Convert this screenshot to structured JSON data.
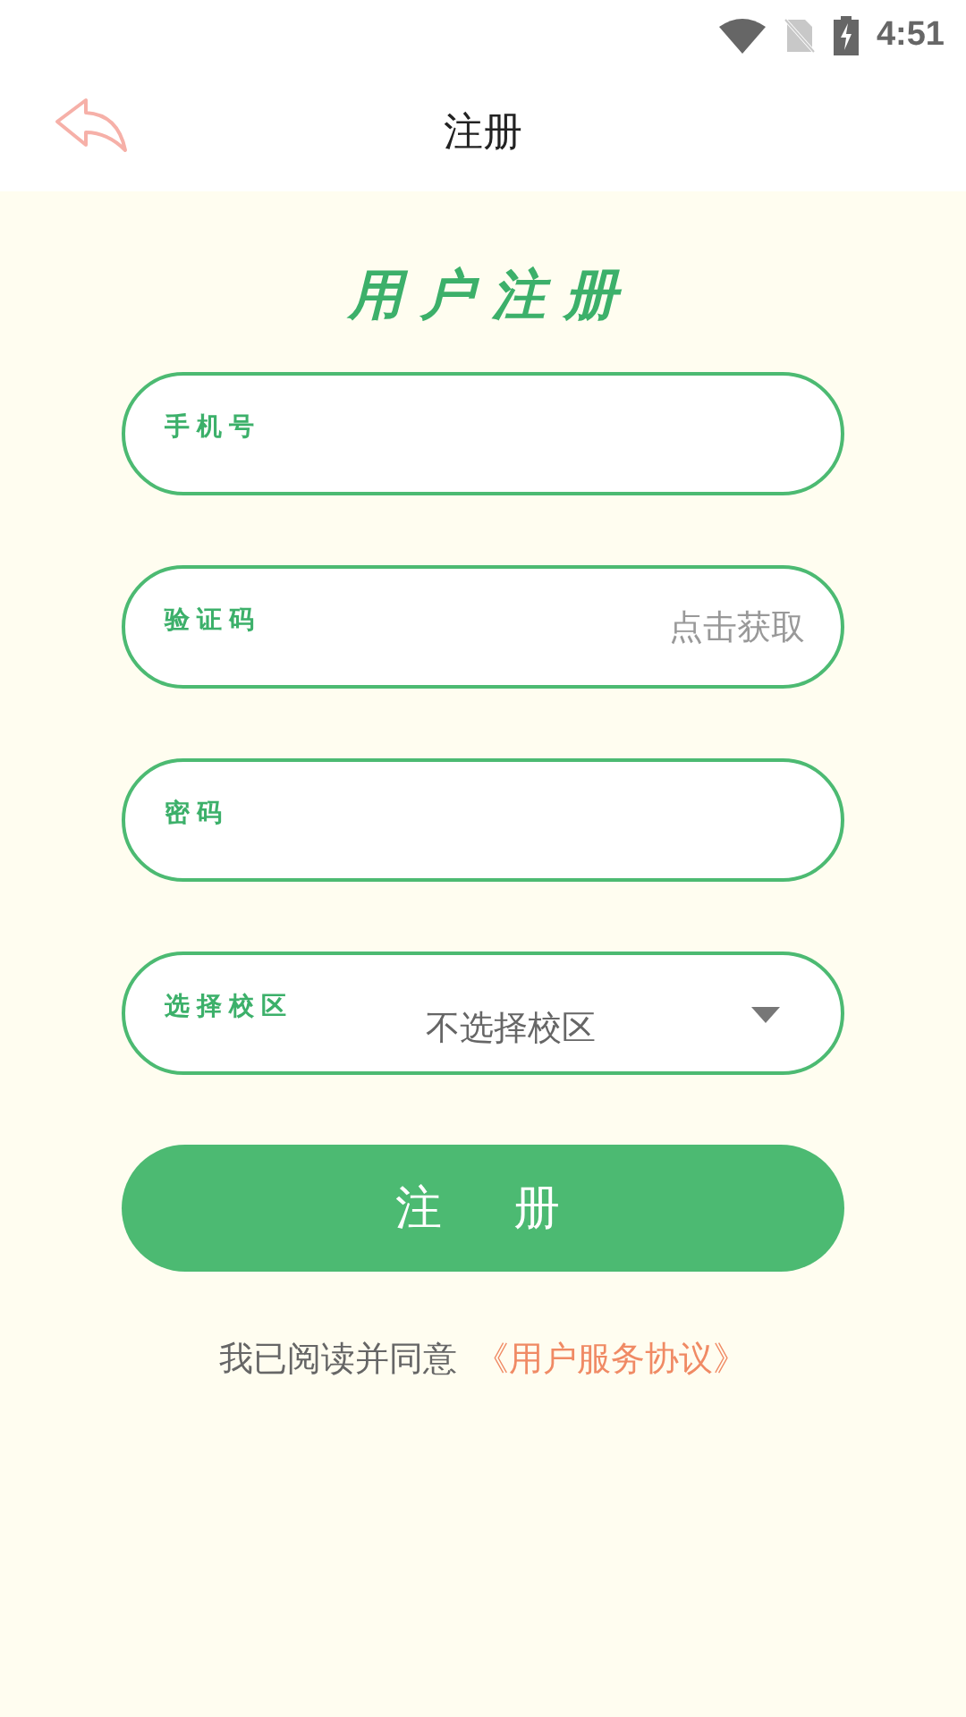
{
  "status_bar": {
    "time": "4:51"
  },
  "header": {
    "title": "注册"
  },
  "heading": "用户注册",
  "fields": [
    {
      "kind": "text",
      "label": "手机号"
    },
    {
      "kind": "code",
      "label": "验证码",
      "action": "点击获取"
    },
    {
      "kind": "text",
      "label": "密码"
    },
    {
      "kind": "select",
      "label": "选择校区",
      "value": "不选择校区"
    }
  ],
  "submit": "注册",
  "agreement": {
    "text": "我已阅读并同意",
    "link": "《用户服务协议》"
  }
}
